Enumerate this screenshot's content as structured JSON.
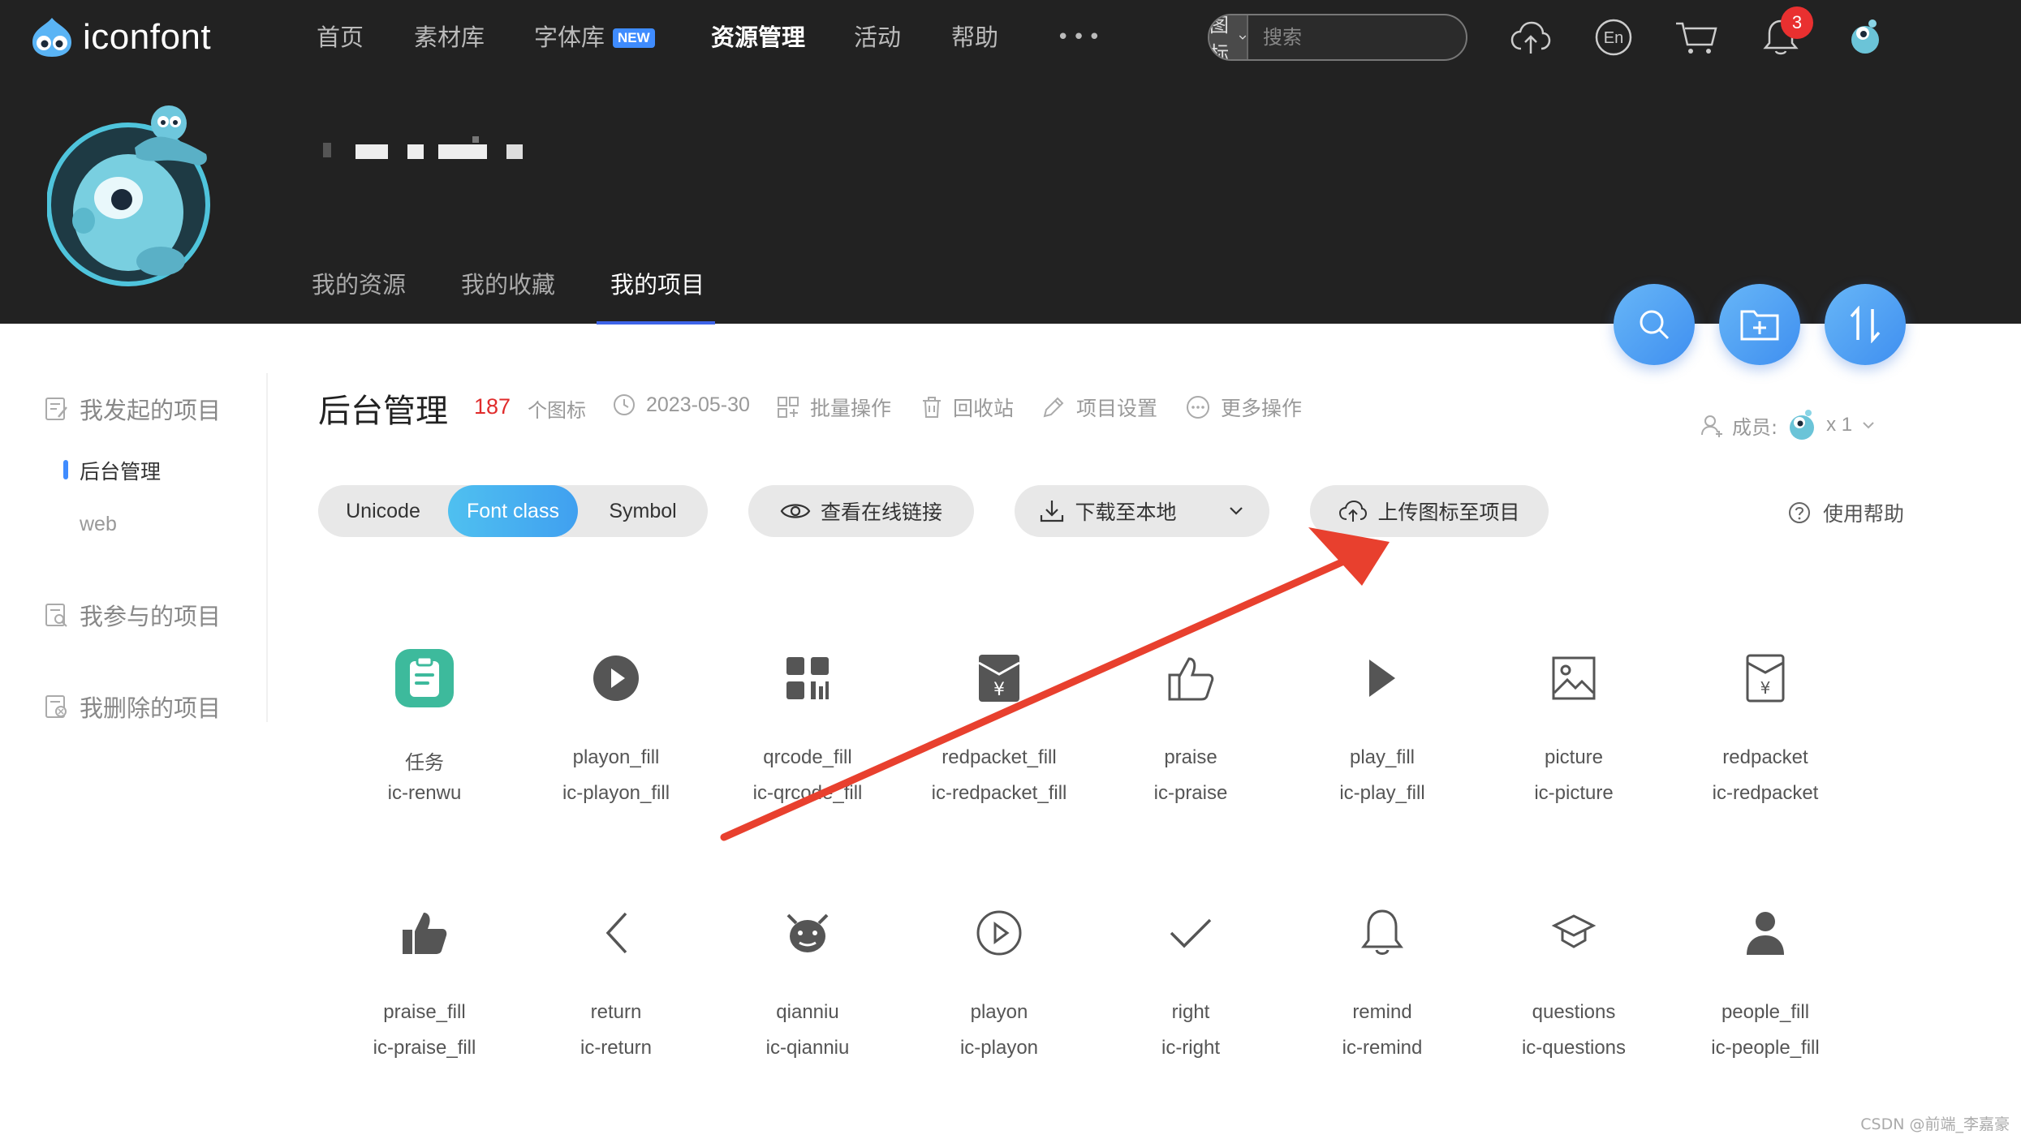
{
  "header": {
    "logo_text": "iconfont",
    "nav": [
      {
        "label": "首页"
      },
      {
        "label": "素材库"
      },
      {
        "label": "字体库",
        "badge": "NEW"
      },
      {
        "label": "资源管理"
      },
      {
        "label": "活动"
      },
      {
        "label": "帮助"
      },
      {
        "label": "•••"
      }
    ],
    "active_nav": "资源管理",
    "search": {
      "type": "图标",
      "placeholder": "搜索"
    },
    "notification_count": "3"
  },
  "profile": {
    "tabs": [
      "我的资源",
      "我的收藏",
      "我的项目"
    ],
    "active_tab": "我的项目"
  },
  "sidebar": {
    "groups": [
      {
        "label": "我发起的项目"
      },
      {
        "label": "我参与的项目"
      },
      {
        "label": "我删除的项目"
      }
    ],
    "projects": [
      {
        "label": "后台管理"
      },
      {
        "label": "web"
      }
    ],
    "active_project": "后台管理"
  },
  "project": {
    "title": "后台管理",
    "count": "187",
    "count_unit": "个图标",
    "date": "2023-05-30",
    "actions": [
      "批量操作",
      "回收站",
      "项目设置",
      "更多操作"
    ],
    "members_label": "成员:",
    "members_count": "x 1"
  },
  "toolbar": {
    "formats": [
      "Unicode",
      "Font class",
      "Symbol"
    ],
    "active_format": "Font class",
    "view_online": "查看在线链接",
    "download": "下载至本地",
    "upload": "上传图标至项目",
    "help": "使用帮助"
  },
  "icons": [
    {
      "name": "任务",
      "class": "ic-renwu",
      "icon": "task-icon"
    },
    {
      "name": "playon_fill",
      "class": "ic-playon_fill",
      "icon": "playon-fill-icon"
    },
    {
      "name": "qrcode_fill",
      "class": "ic-qrcode_fill",
      "icon": "qrcode-fill-icon"
    },
    {
      "name": "redpacket_fill",
      "class": "ic-redpacket_fill",
      "icon": "redpacket-fill-icon"
    },
    {
      "name": "praise",
      "class": "ic-praise",
      "icon": "praise-icon"
    },
    {
      "name": "play_fill",
      "class": "ic-play_fill",
      "icon": "play-fill-icon"
    },
    {
      "name": "picture",
      "class": "ic-picture",
      "icon": "picture-icon"
    },
    {
      "name": "redpacket",
      "class": "ic-redpacket",
      "icon": "redpacket-icon"
    },
    {
      "name": "praise_fill",
      "class": "ic-praise_fill",
      "icon": "praise-fill-icon"
    },
    {
      "name": "return",
      "class": "ic-return",
      "icon": "return-icon"
    },
    {
      "name": "qianniu",
      "class": "ic-qianniu",
      "icon": "qianniu-icon"
    },
    {
      "name": "playon",
      "class": "ic-playon",
      "icon": "playon-icon"
    },
    {
      "name": "right",
      "class": "ic-right",
      "icon": "right-icon"
    },
    {
      "name": "remind",
      "class": "ic-remind",
      "icon": "remind-icon"
    },
    {
      "name": "questions",
      "class": "ic-questions",
      "icon": "questions-icon"
    },
    {
      "name": "people_fill",
      "class": "ic-people_fill",
      "icon": "people-fill-icon"
    }
  ],
  "watermark": "CSDN @前端_李嘉豪",
  "colors": {
    "header_bg": "#222222",
    "accent": "#3f8cff",
    "count_red": "#e02b2b",
    "arrow_red": "#e8402e",
    "task_green": "#3dba9c"
  }
}
